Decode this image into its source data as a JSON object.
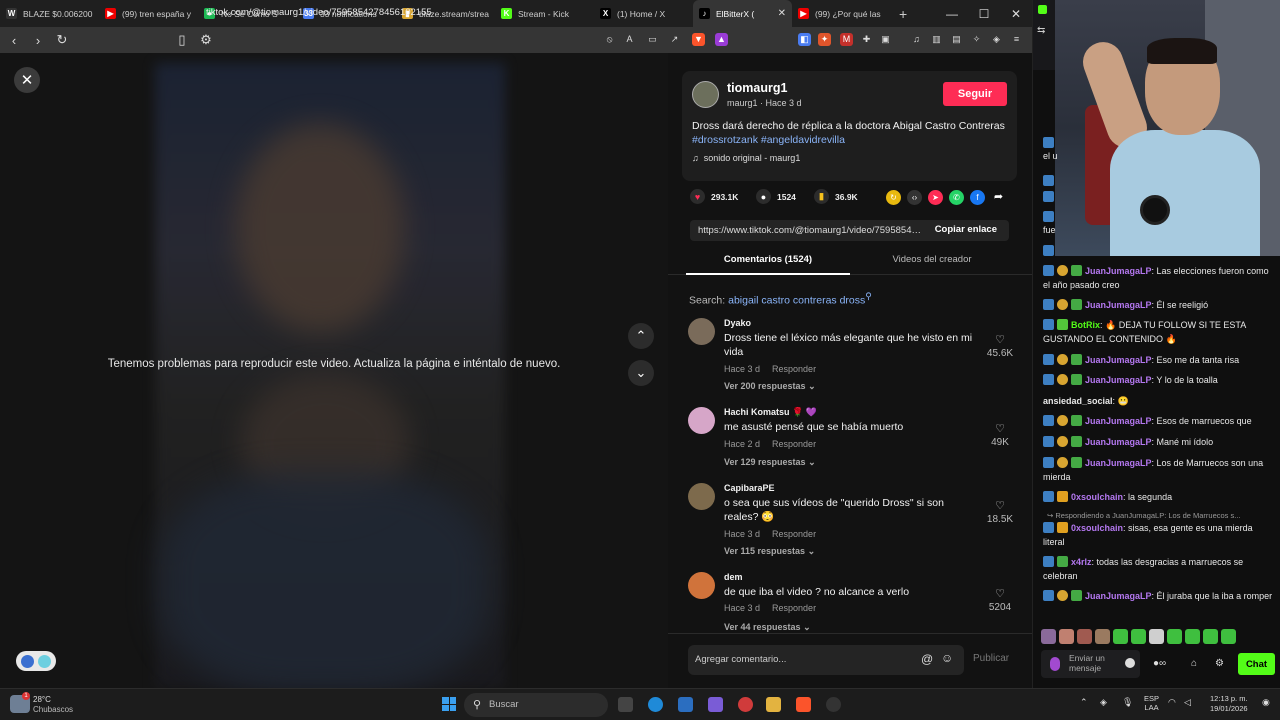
{
  "browser": {
    "tabs": [
      {
        "title": "BLAZE $0.006200",
        "color": "#333",
        "glyph": "W"
      },
      {
        "title": "(99) tren españa y",
        "color": "#e00",
        "glyph": "▶"
      },
      {
        "title": "No Sé Como S",
        "color": "#1db954",
        "glyph": "●"
      },
      {
        "title": "33 notifications",
        "color": "#4a7cf0",
        "glyph": "33"
      },
      {
        "title": "blaze.stream/strea",
        "color": "#d8a531",
        "glyph": "▮"
      },
      {
        "title": "Stream - Kick",
        "color": "#53fc18",
        "glyph": "K"
      },
      {
        "title": "(1) Home / X",
        "color": "#000",
        "glyph": "X"
      },
      {
        "title": "ElBitterX (",
        "color": "#000",
        "glyph": "♪"
      },
      {
        "title": "(99) ¿Por qué las",
        "color": "#e00",
        "glyph": "▶"
      }
    ],
    "active_tab": 7,
    "url": "tiktok.com/@tiomaurg1/video/7595854278456102155",
    "window_controls": [
      "—",
      "☐",
      "✕"
    ]
  },
  "video": {
    "error_message": "Tenemos problemas para reproducir este video. Actualiza la página e inténtalo de nuevo."
  },
  "post": {
    "author": "tiomaurg1",
    "author_sub": "maurg1 · Hace 3 d",
    "follow_label": "Seguir",
    "description": "Dross dará derecho de réplica a la doctora Abigal Castro Contreras ",
    "hashtags": [
      "#drossrotzank",
      "#angeldavidrevilla"
    ],
    "sound": "sonido original - maurg1",
    "likes": "293.1K",
    "comments": "1524",
    "saves": "36.9K",
    "share_link": "https://www.tiktok.com/@tiomaurg1/video/7595854278456102155",
    "copy_label": "Copiar enlace",
    "tab_comments": "Comentarios (1524)",
    "tab_creator": "Videos del creador",
    "search_label": "Search: ",
    "search_query": "abigail castro contreras dross",
    "comment_placeholder": "Agregar comentario...",
    "post_label": "Publicar"
  },
  "comments": [
    {
      "user": "Dyako",
      "text": "Dross tiene el léxico más elegante que he visto en mi vida",
      "time": "Hace 3 d",
      "reply": "Responder",
      "more": "Ver 200 respuestas",
      "likes": "45.6K"
    },
    {
      "user": "Hachi Komatsu 🌹 💜",
      "text": "me asusté pensé que se había muerto",
      "time": "Hace 2 d",
      "reply": "Responder",
      "more": "Ver 129 respuestas",
      "likes": "49K"
    },
    {
      "user": "CapibaraPE",
      "text": "o sea que sus vídeos de \"querido Dross\" si son reales? 😳",
      "time": "Hace 3 d",
      "reply": "Responder",
      "more": "Ver 115 respuestas",
      "likes": "18.5K"
    },
    {
      "user": "dem",
      "text": "de que iba el video ? no alcance a verlo",
      "time": "Hace 3 d",
      "reply": "Responder",
      "more": "Ver 44 respuestas",
      "likes": "5204"
    }
  ],
  "chat": {
    "fragments": [
      "el u",
      "fue"
    ],
    "messages": [
      {
        "user": "JuanJumagaLP",
        "color": "#b478f0",
        "text": "Las elecciones fueron como el año pasado creo"
      },
      {
        "user": "JuanJumagaLP",
        "color": "#b478f0",
        "text": "Él se reeligió"
      },
      {
        "user": "BotRix",
        "color": "#53fc18",
        "text": "🔥 DEJA TU FOLLOW SI TE ESTA GUSTANDO EL CONTENIDO 🔥"
      },
      {
        "user": "JuanJumagaLP",
        "color": "#b478f0",
        "text": "Eso me da tanta risa"
      },
      {
        "user": "JuanJumagaLP",
        "color": "#b478f0",
        "text": "Y lo de la toalla"
      },
      {
        "user": "ansiedad_social",
        "color": "#e8e8e8",
        "text": "😬"
      },
      {
        "user": "JuanJumagaLP",
        "color": "#b478f0",
        "text": "Esos de marruecos que"
      },
      {
        "user": "JuanJumagaLP",
        "color": "#b478f0",
        "text": "Mané mi ídolo"
      },
      {
        "user": "JuanJumagaLP",
        "color": "#b478f0",
        "text": "Los de Marruecos son una mierda"
      },
      {
        "user": "0xsoulchain",
        "color": "#b478f0",
        "text": "la segunda"
      },
      {
        "user": "0xsoulchain",
        "color": "#b478f0",
        "text": "sisas, esa gente es una mierda literal"
      },
      {
        "user": "x4rlz",
        "color": "#b478f0",
        "text": "todas las desgracias a marruecos se celebran"
      },
      {
        "user": "JuanJumagaLP",
        "color": "#b478f0",
        "text": "Él juraba que la iba a romper"
      }
    ],
    "reply_context": "Respondiendo a JuanJumagaLP: Los de Marruecos s...",
    "input_placeholder": "Enviar un mensaje",
    "send_label": "Chat"
  },
  "taskbar": {
    "temp": "28°C",
    "weather": "Chubascos",
    "alert": "1",
    "search": "Buscar",
    "lang": "ESP\nLAA",
    "time": "12:13 p. m.",
    "date": "19/01/2026"
  }
}
